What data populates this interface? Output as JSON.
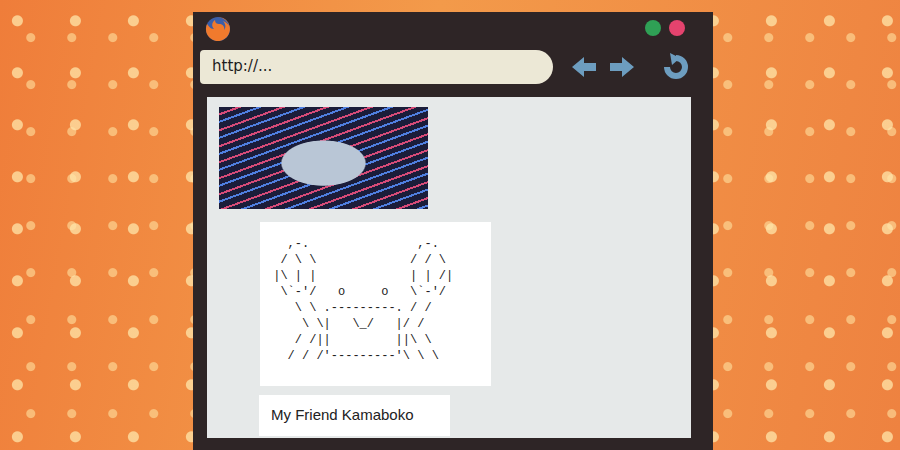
{
  "browser": {
    "address": "http://..."
  },
  "content": {
    "ascii_art": [
      "   ,-.               ,-.",
      "  / \\ \\             / / \\",
      " |\\ | |             | | /|",
      "  \\`-'/   o     o   \\`-'/",
      "    \\ \\ .---------. / /",
      "     \\ \\|   \\_/   |/ /",
      "    / /||         ||\\ \\",
      "   / / /'---------'\\ \\ \\"
    ],
    "caption": "My Friend Kamaboko"
  }
}
